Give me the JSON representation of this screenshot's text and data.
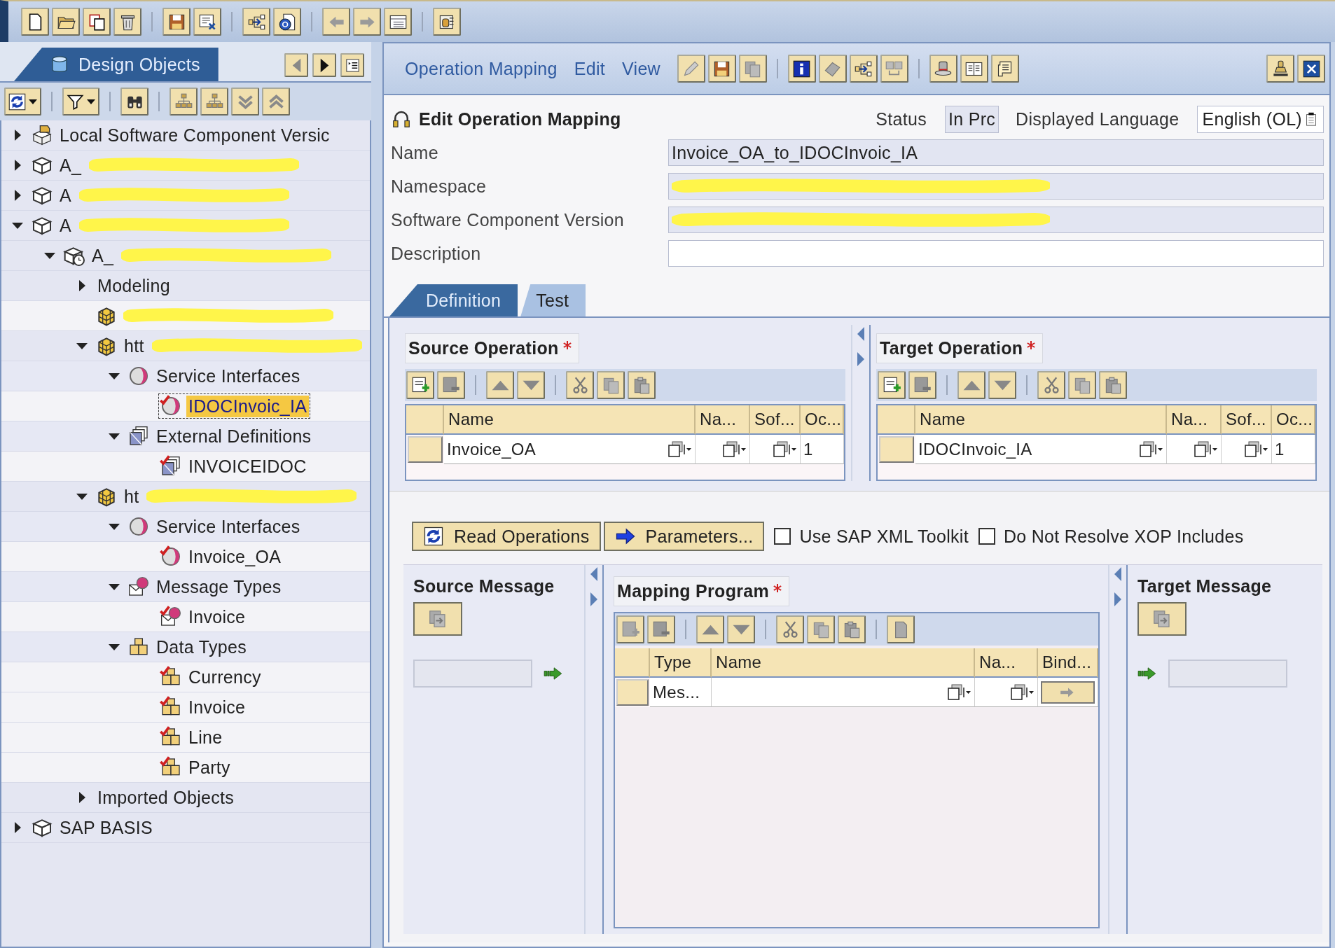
{
  "navigator": {
    "tab": "Design Objects",
    "tree": [
      {
        "label": "Local Software Component Versic",
        "kind": "local-swc",
        "expanded": false,
        "selected": false
      },
      {
        "label": "A_",
        "kind": "swc",
        "redacted": true,
        "expanded": false,
        "selected": false
      },
      {
        "label": "A",
        "kind": "swc",
        "redacted": true,
        "expanded": false,
        "selected": false
      },
      {
        "label": "A",
        "kind": "swc",
        "redacted": true,
        "expanded": true,
        "selected": false,
        "children": [
          {
            "label": "A_",
            "kind": "swc-version",
            "redacted": true,
            "expanded": true,
            "selected": false,
            "children": [
              {
                "label": "Modeling",
                "expanded": false,
                "selected": false
              },
              {
                "kind": "namespace",
                "redacted": true,
                "selected": false
              },
              {
                "label": "htt",
                "kind": "namespace",
                "redacted": true,
                "expanded": true,
                "selected": false,
                "children": [
                  {
                    "label": "Service Interfaces",
                    "kind": "service-interface",
                    "expanded": true,
                    "selected": false,
                    "children": [
                      {
                        "label": "IDOCInvoic_IA",
                        "kind": "service-interface",
                        "selected": true
                      }
                    ]
                  },
                  {
                    "label": "External Definitions",
                    "kind": "external-definition",
                    "expanded": true,
                    "selected": false,
                    "children": [
                      {
                        "label": "INVOICEIDOC",
                        "kind": "external-definition",
                        "selected": false
                      }
                    ]
                  }
                ]
              },
              {
                "label": "ht",
                "kind": "namespace",
                "redacted": true,
                "expanded": true,
                "selected": false,
                "children": [
                  {
                    "label": "Service Interfaces",
                    "kind": "service-interface",
                    "expanded": true,
                    "selected": false,
                    "children": [
                      {
                        "label": "Invoice_OA",
                        "kind": "service-interface",
                        "selected": false
                      }
                    ]
                  },
                  {
                    "label": "Message Types",
                    "kind": "message-type",
                    "expanded": true,
                    "selected": false,
                    "children": [
                      {
                        "label": "Invoice",
                        "kind": "message-type",
                        "selected": false
                      }
                    ]
                  },
                  {
                    "label": "Data Types",
                    "kind": "data-type",
                    "expanded": true,
                    "selected": false,
                    "children": [
                      {
                        "label": "Currency",
                        "kind": "data-type",
                        "selected": false
                      },
                      {
                        "label": "Invoice",
                        "kind": "data-type",
                        "selected": false
                      },
                      {
                        "label": "Line",
                        "kind": "data-type",
                        "selected": false
                      },
                      {
                        "label": "Party",
                        "kind": "data-type",
                        "selected": false
                      }
                    ]
                  }
                ]
              },
              {
                "label": "Imported Objects",
                "expanded": false,
                "selected": false
              }
            ]
          }
        ]
      },
      {
        "label": "SAP BASIS",
        "kind": "swc",
        "expanded": false,
        "selected": false
      }
    ]
  },
  "editor": {
    "menus": [
      {
        "label": "Operation Mapping"
      },
      {
        "label": "Edit"
      },
      {
        "label": "View"
      }
    ],
    "title": "Edit Operation Mapping",
    "status_label": "Status",
    "status": "In Prc",
    "language_label": "Displayed Language",
    "language": "English (OL)",
    "fields": [
      {
        "label": "Name",
        "value": "Invoice_OA_to_IDOCInvoic_IA",
        "editable": false
      },
      {
        "label": "Namespace",
        "redacted": true,
        "editable": false
      },
      {
        "label": "Software Component Version",
        "redacted": true,
        "editable": false
      },
      {
        "label": "Description",
        "editable": true
      }
    ],
    "tabs": [
      {
        "label": "Definition",
        "selected": true
      },
      {
        "label": "Test",
        "selected": false
      }
    ],
    "operations": [
      {
        "title": "Source Operation",
        "required": true,
        "columns": [
          "Name",
          "Na...",
          "Sof...",
          "Oc..."
        ],
        "rows": [
          {
            "name": "Invoice_OA",
            "occurrence": "1"
          }
        ]
      },
      {
        "title": "Target Operation",
        "required": true,
        "columns": [
          "Name",
          "Na...",
          "Sof...",
          "Oc..."
        ],
        "rows": [
          {
            "name": "IDOCInvoic_IA",
            "occurrence": "1"
          }
        ]
      }
    ],
    "buttons": [
      "Read Operations",
      "Parameters..."
    ],
    "options": [
      {
        "label": "Use SAP XML Toolkit",
        "checked": false
      },
      {
        "label": "Do Not Resolve XOP Includes",
        "checked": false
      }
    ],
    "source_message": {
      "title": "Source Message"
    },
    "mapping_program": {
      "title": "Mapping Program",
      "required": true,
      "columns": [
        "Type",
        "Name",
        "Na...",
        "Bind..."
      ],
      "rows": [
        {
          "type": "Mes..."
        }
      ]
    },
    "target_message": {
      "title": "Target Message"
    }
  }
}
